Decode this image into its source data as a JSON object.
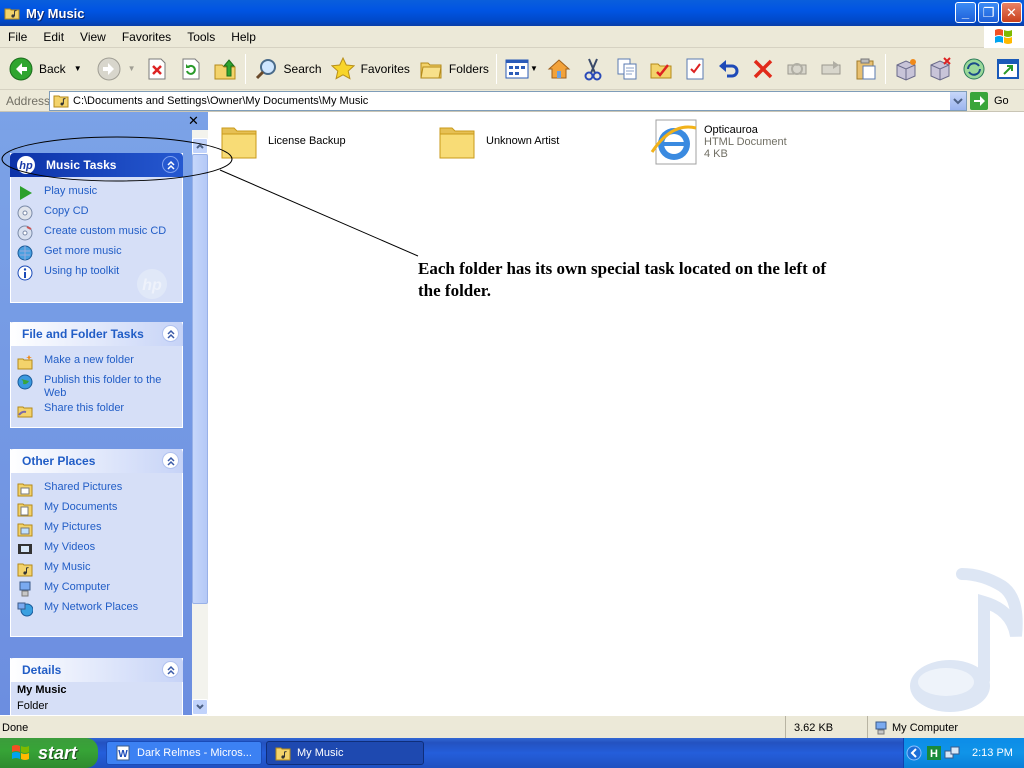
{
  "window": {
    "title": "My Music"
  },
  "menu": [
    "File",
    "Edit",
    "View",
    "Favorites",
    "Tools",
    "Help"
  ],
  "toolbar": {
    "back": "Back",
    "search": "Search",
    "favorites": "Favorites",
    "folders": "Folders"
  },
  "address": {
    "label": "Address",
    "path": "C:\\Documents and Settings\\Owner\\My Documents\\My Music",
    "go": "Go"
  },
  "panels": {
    "music": {
      "title": "Music Tasks",
      "items": [
        "Play music",
        "Copy CD",
        "Create custom music CD",
        "Get more music",
        "Using hp toolkit"
      ]
    },
    "file": {
      "title": "File and Folder Tasks",
      "items": [
        "Make a new folder",
        "Publish this folder to the Web",
        "Share this folder"
      ]
    },
    "other": {
      "title": "Other Places",
      "items": [
        "Shared Pictures",
        "My Documents",
        "My Pictures",
        "My Videos",
        "My Music",
        "My Computer",
        "My Network Places"
      ]
    },
    "details": {
      "title": "Details",
      "name": "My Music",
      "type": "Folder"
    }
  },
  "files": [
    {
      "name": "License Backup"
    },
    {
      "name": "Unknown Artist"
    },
    {
      "name": "Opticauroa",
      "type": "HTML Document",
      "size": "4 KB"
    }
  ],
  "annotation": "Each folder has its own special task located on the left of the folder.",
  "status": {
    "text": "Done",
    "size": "3.62 KB",
    "zone": "My Computer"
  },
  "taskbar": {
    "start": "start",
    "items": [
      "Dark Relmes - Micros...",
      "My Music"
    ],
    "clock": "2:13 PM"
  }
}
